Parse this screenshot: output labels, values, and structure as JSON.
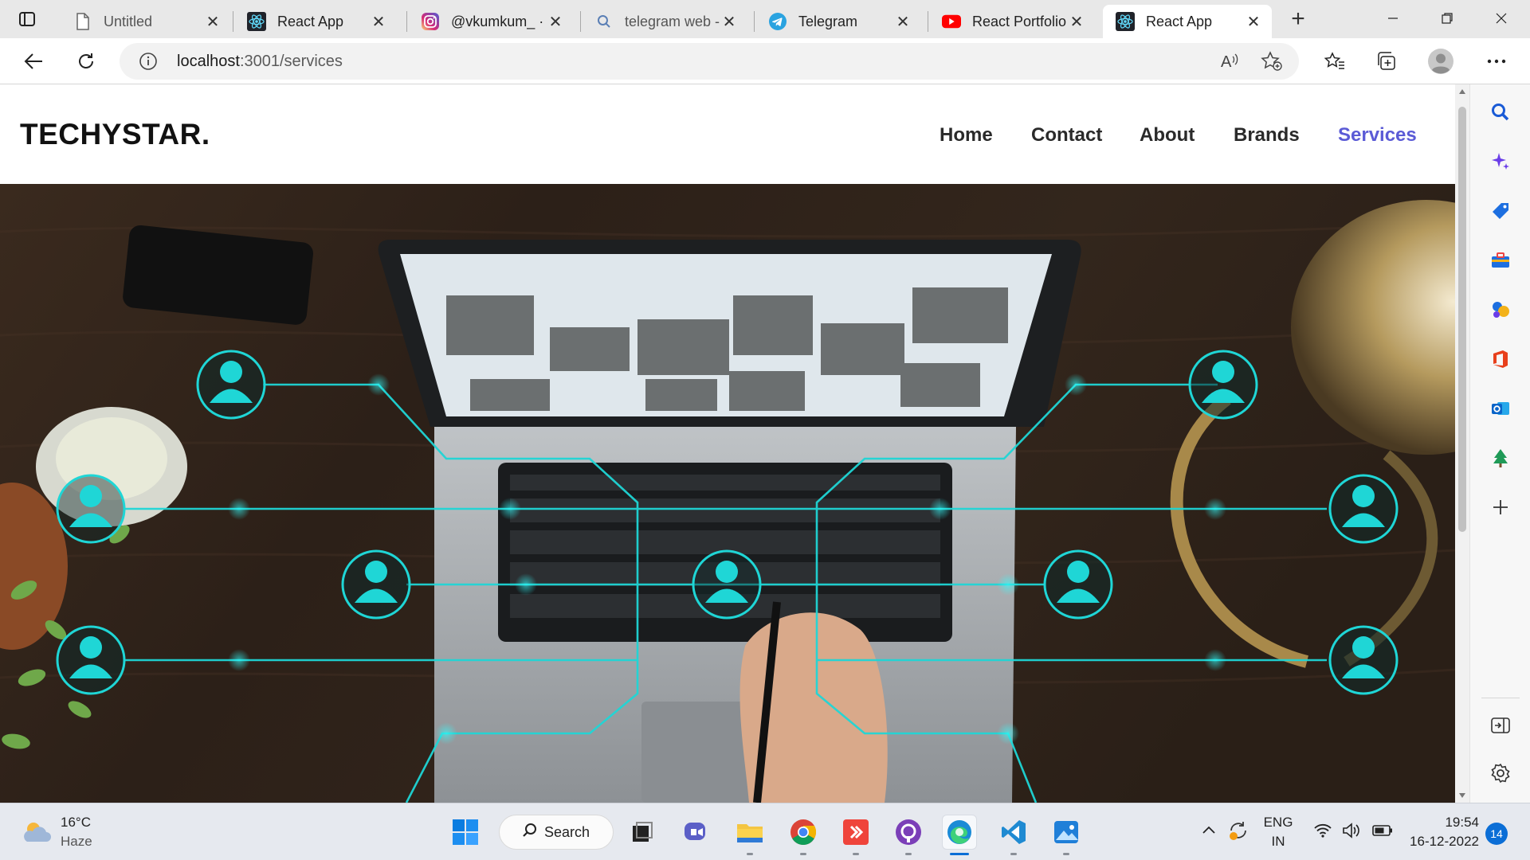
{
  "browser": {
    "tabs": [
      {
        "title": "Untitled",
        "icon": "page-icon"
      },
      {
        "title": "React App",
        "icon": "react-icon"
      },
      {
        "title": "@vkumkum_ ·",
        "icon": "instagram-icon"
      },
      {
        "title": "telegram web -",
        "icon": "search-icon"
      },
      {
        "title": "Telegram",
        "icon": "telegram-icon"
      },
      {
        "title": "React Portfolio",
        "icon": "youtube-icon"
      },
      {
        "title": "React App",
        "icon": "react-icon",
        "active": true
      }
    ],
    "url_host": "localhost",
    "url_rest": ":3001/services"
  },
  "site": {
    "logo": "TECHYSTAR.",
    "nav": [
      {
        "label": "Home"
      },
      {
        "label": "Contact"
      },
      {
        "label": "About"
      },
      {
        "label": "Brands"
      },
      {
        "label": "Services",
        "active": true
      }
    ],
    "accent_color": "#5b5bd6",
    "network_color": "#1fd6d6"
  },
  "taskbar": {
    "weather_temp": "16°C",
    "weather_desc": "Haze",
    "search_label": "Search",
    "lang_top": "ENG",
    "lang_bottom": "IN",
    "time": "19:54",
    "date": "16-12-2022",
    "notifications": "14"
  }
}
